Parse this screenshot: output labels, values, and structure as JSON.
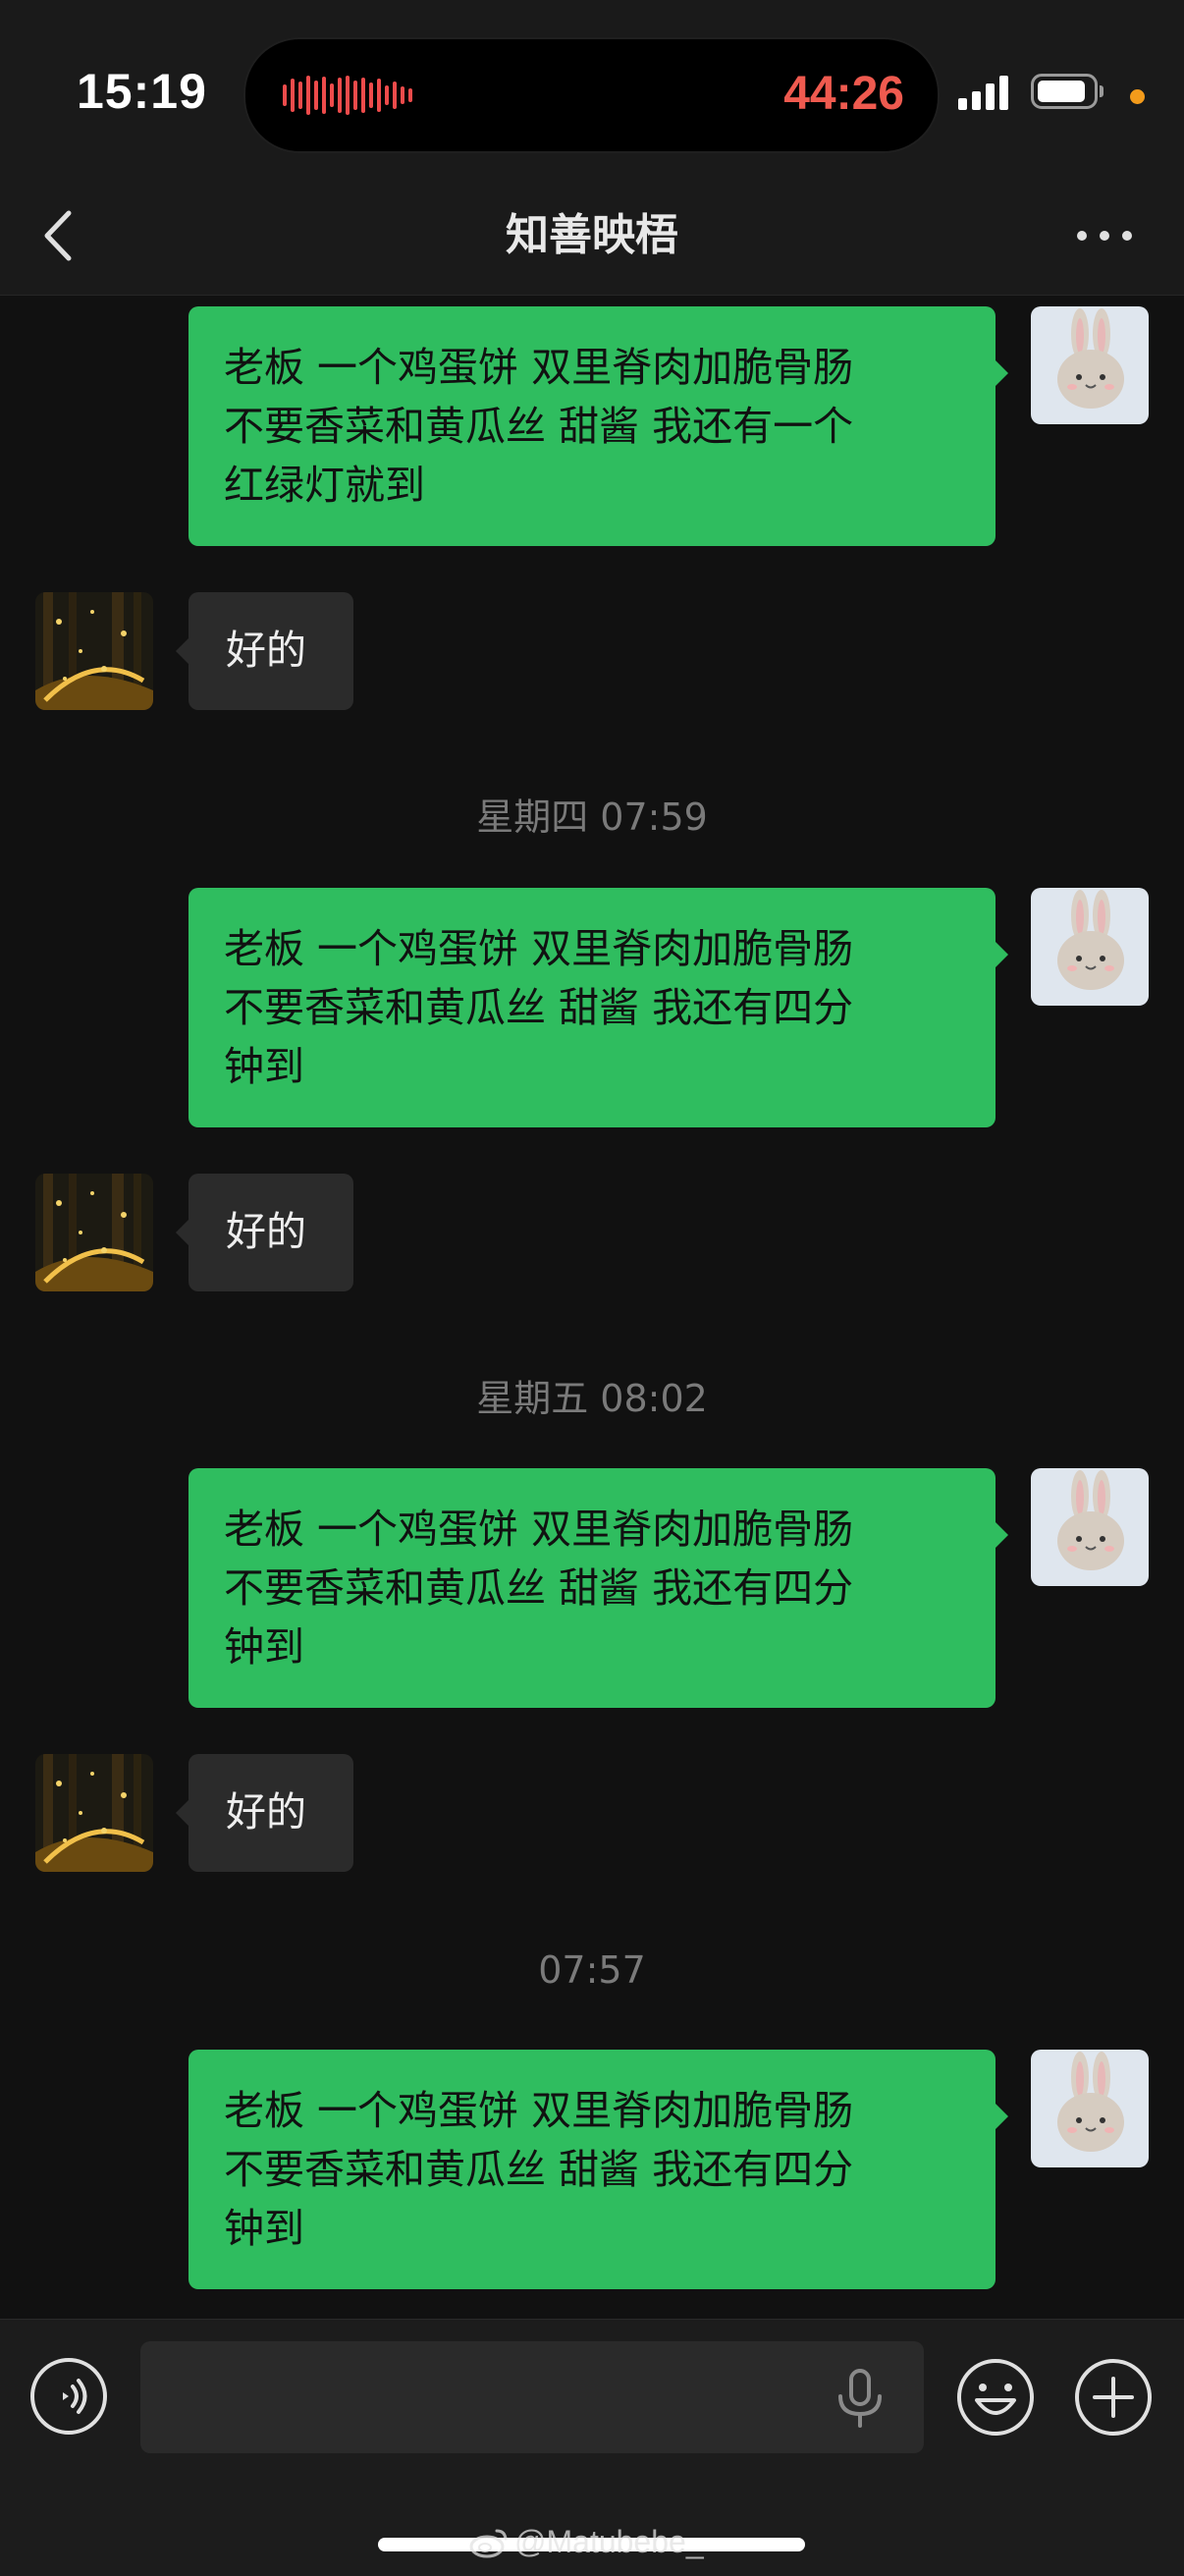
{
  "status_bar": {
    "time": "15:19",
    "recording_timer": "44:26",
    "recording_color": "#ef5a4f",
    "privacy_dot_color": "#f39b1b"
  },
  "header": {
    "title": "知善映梧",
    "back_icon": "chevron-left-icon",
    "more_icon": "more-dots-icon"
  },
  "messages": [
    {
      "type": "mine",
      "text": "老板 一个鸡蛋饼 双里脊肉加脆骨肠\n不要香菜和黄瓜丝 甜酱 我还有一个\n红绿灯就到"
    },
    {
      "type": "theirs",
      "text": "好的"
    },
    {
      "type": "time",
      "text": "星期四 07:59"
    },
    {
      "type": "mine",
      "text": "老板 一个鸡蛋饼 双里脊肉加脆骨肠\n不要香菜和黄瓜丝 甜酱 我还有四分\n钟到"
    },
    {
      "type": "theirs",
      "text": "好的"
    },
    {
      "type": "time",
      "text": "星期五 08:02"
    },
    {
      "type": "mine",
      "text": "老板 一个鸡蛋饼 双里脊肉加脆骨肠\n不要香菜和黄瓜丝 甜酱 我还有四分\n钟到"
    },
    {
      "type": "theirs",
      "text": "好的"
    },
    {
      "type": "time",
      "text": "07:57"
    },
    {
      "type": "mine",
      "text": "老板 一个鸡蛋饼 双里脊肉加脆骨肠\n不要香菜和黄瓜丝 甜酱 我还有四分\n钟到"
    }
  ],
  "input_bar": {
    "value": "",
    "voice_icon": "voice-mode-icon",
    "mic_icon": "microphone-icon",
    "emoji_icon": "emoji-icon",
    "plus_icon": "plus-icon"
  },
  "watermark": {
    "text": "@Matubebe_",
    "icon": "weibo-icon"
  },
  "colors": {
    "sent_bubble": "#2fbd5f",
    "received_bubble": "#2b2b2b",
    "background": "#111111"
  }
}
